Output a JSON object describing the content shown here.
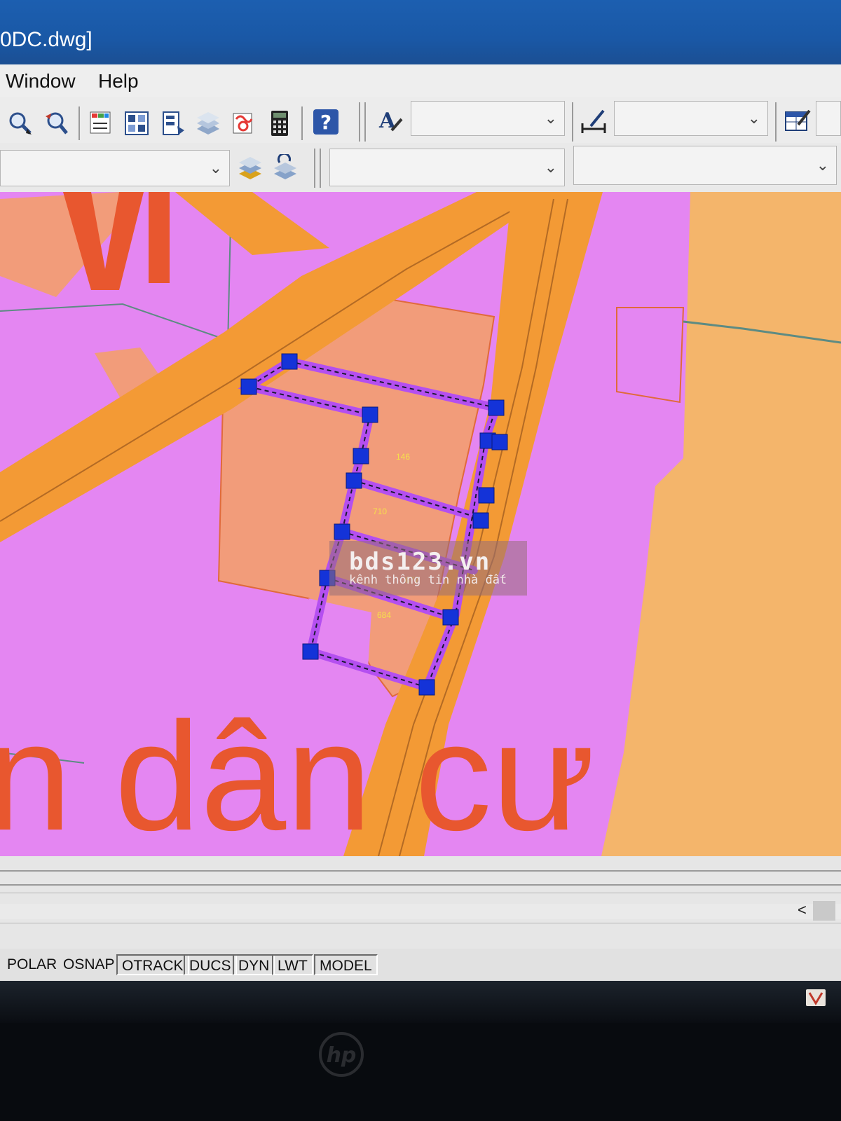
{
  "window": {
    "title": "0DC.dwg]"
  },
  "menu": {
    "items": [
      "Window",
      "Help"
    ]
  },
  "toolbar": {
    "icons": [
      "zoom-realtime-icon",
      "zoom-previous-icon",
      "properties-icon",
      "design-center-icon",
      "tool-palettes-icon",
      "sheet-set-icon",
      "markup-icon",
      "calculator-icon",
      "help-icon",
      "text-style-icon",
      "dimension-style-icon",
      "table-style-icon"
    ],
    "text_style_value": "",
    "dim_style_value": "",
    "layer_value": "",
    "color_value": "",
    "linetype_value": ""
  },
  "drawing": {
    "lot_labels": [
      "146",
      "710",
      "677",
      "684"
    ],
    "map_text": [
      "n dân cư"
    ],
    "colors": {
      "residential": "#e486f2",
      "road": "#f39a35",
      "lot": "#f29c7a",
      "orange_zone": "#f4b56b",
      "selection": "#b44ff0",
      "grip": "#1433d8"
    }
  },
  "watermark": {
    "title": "bds123.vn",
    "subtitle": "kênh thông tin nhà đất"
  },
  "statusbar": {
    "buttons": [
      "POLAR",
      "OSNAP",
      "OTRACK",
      "DUCS",
      "DYN",
      "LWT",
      "MODEL"
    ]
  },
  "scroll": {
    "left_arrow": "<"
  },
  "device": {
    "brand": "hp"
  }
}
